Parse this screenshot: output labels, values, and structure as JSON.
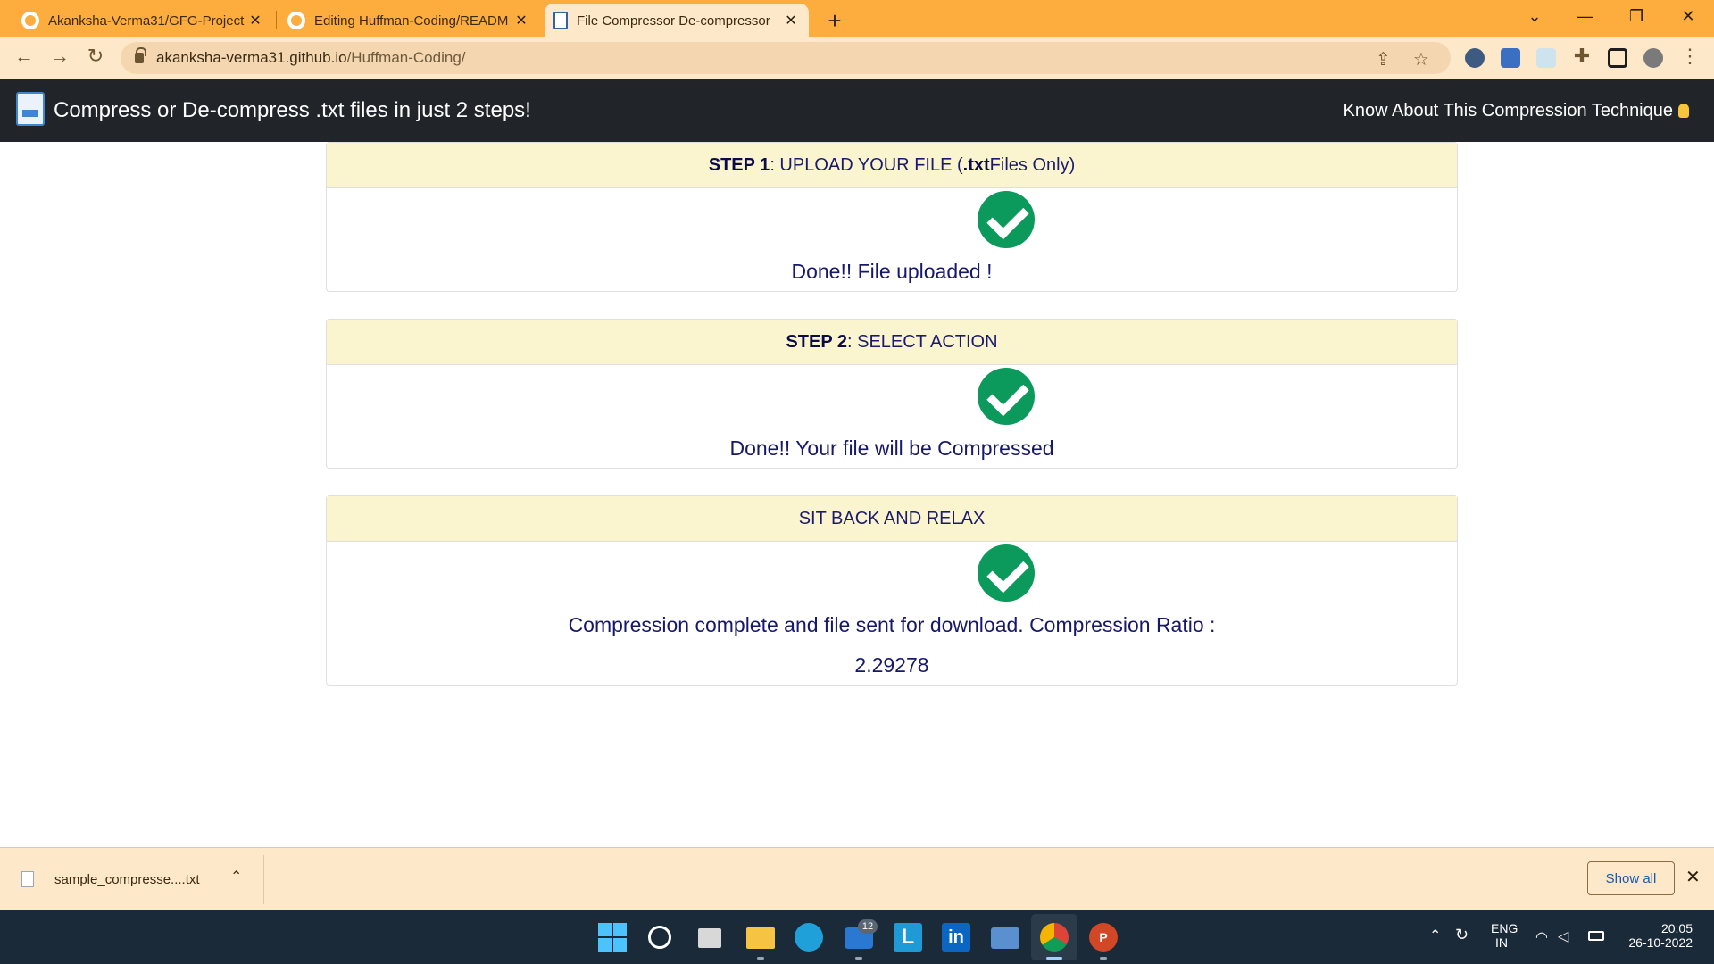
{
  "browser": {
    "tabs": [
      {
        "title": "Akanksha-Verma31/GFG-Project",
        "icon": "github-icon",
        "active": false
      },
      {
        "title": "Editing Huffman-Coding/READM",
        "icon": "github-icon",
        "active": false
      },
      {
        "title": "File Compressor De-compressor",
        "icon": "document-icon",
        "active": true
      }
    ],
    "close_glyph": "✕",
    "new_tab_glyph": "+",
    "url_host": "akanksha-verma31.github.io",
    "url_path": "/Huffman-Coding/"
  },
  "app": {
    "title": "Compress or De-compress .txt files in just 2 steps!",
    "nav_link": "Know About This Compression Technique"
  },
  "steps": [
    {
      "header_bold": "STEP 1",
      "header_pre": ": UPLOAD YOUR FILE (",
      "header_bold2": ".txt",
      "header_post": " Files Only)",
      "message": "Done!! File uploaded !"
    },
    {
      "header_bold": "STEP 2",
      "header_pre": ": SELECT ACTION",
      "message": "Done!! Your file will be Compressed"
    },
    {
      "header_pre": "SIT BACK AND RELAX",
      "message": "Compression complete and file sent for download. Compression Ratio :",
      "ratio": "2.29278"
    }
  ],
  "download_bar": {
    "file_name": "sample_compresse....txt",
    "show_all": "Show all"
  },
  "taskbar": {
    "mail_badge": "12",
    "language": "ENG",
    "region": "IN",
    "time": "20:05",
    "date": "26-10-2022"
  },
  "colors": {
    "tabstrip": "#fcad3e",
    "appbar": "#212529",
    "card_header": "#fbf5cf",
    "check": "#0b9a5b",
    "text": "#17186a"
  }
}
